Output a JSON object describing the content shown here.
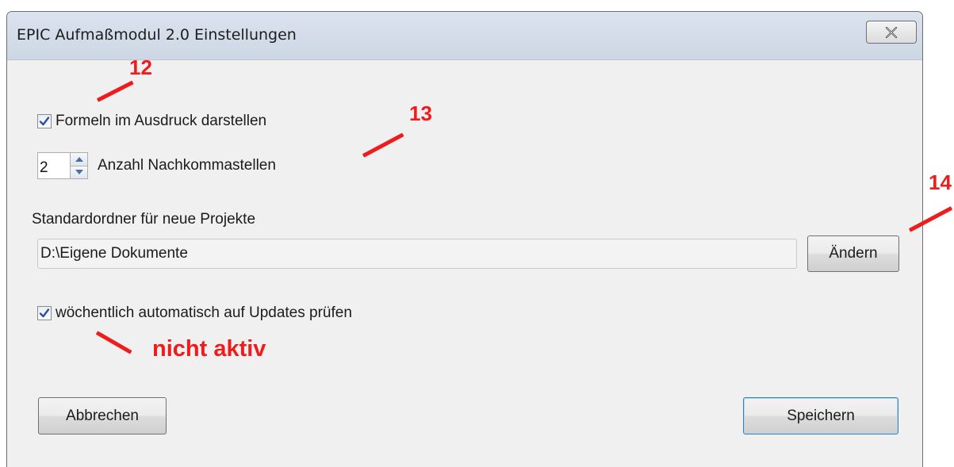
{
  "window": {
    "title": "EPIC Aufmaßmodul 2.0 Einstellungen",
    "close_icon": "close-x-icon"
  },
  "settings": {
    "show_formulas": {
      "label": "Formeln im Ausdruck darstellen",
      "checked": true
    },
    "decimal_places": {
      "value": "2",
      "label": "Anzahl Nachkommastellen"
    },
    "default_folder": {
      "label": "Standardordner für neue Projekte",
      "path": "D:\\Eigene Dokumente",
      "change_button": "Ändern"
    },
    "weekly_updates": {
      "label": "wöchentlich automatisch auf Updates prüfen",
      "checked": true
    }
  },
  "buttons": {
    "cancel": "Abbrechen",
    "save": "Speichern"
  },
  "annotations": {
    "marker_12": "12",
    "marker_13": "13",
    "marker_14": "14",
    "note_inactive": "nicht aktiv",
    "color": "#ee1c1c"
  }
}
